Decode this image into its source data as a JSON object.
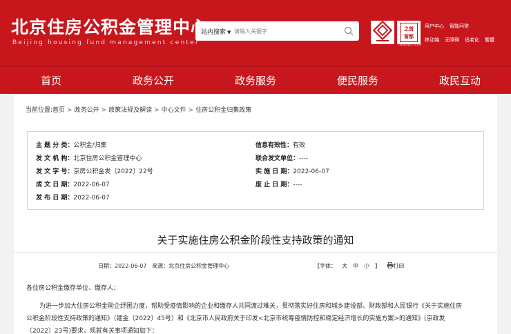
{
  "header": {
    "title": "北京住房公积金管理中心",
    "subtitle": "Beijing housing fund management center",
    "search": {
      "scope": "站内搜索",
      "placeholder": "请输入关键字"
    },
    "logo_b_text_top": "之首",
    "logo_b_text_bottom": "窗都",
    "logo_b_caption": "Beijing·China",
    "tools_row1": [
      "用户中心",
      "智能问答"
    ],
    "tools_row2": [
      "移动端",
      "无障碍",
      "适老化",
      "繁體"
    ]
  },
  "nav": [
    "首页",
    "政务公开",
    "政务服务",
    "便民服务",
    "政民互动"
  ],
  "breadcrumb": [
    "当前位置:首页",
    "政务公开",
    "政策法规及解读",
    "中心文件",
    "住房公积金归集政策"
  ],
  "meta": {
    "left": [
      {
        "label": "主 题 分 类：",
        "value": "公积金/归集"
      },
      {
        "label": "发 文 机 构：",
        "value": "北京住房公积金管理中心"
      },
      {
        "label": "发 文 字 号：",
        "value": "京房公积金发〔2022〕22号"
      },
      {
        "label": "成 文 日 期：",
        "value": "2022-06-07"
      },
      {
        "label": "发 布 日 期：",
        "value": "2022-06-07"
      }
    ],
    "right": [
      {
        "label": "信息有效性：",
        "value": "有效"
      },
      {
        "label": "联合发文单位：",
        "value": "----"
      },
      {
        "label": "实 施 日 期：",
        "value": "2022-06-07"
      },
      {
        "label": "废 止 日 期：",
        "value": "----"
      }
    ]
  },
  "doc_title": "关于实施住房公积金阶段性支持政策的通知",
  "info": {
    "date": "日期：2022-06-07",
    "source": "来源：北京住房公积金管理中心",
    "font_label": "【字体：",
    "font_large": "大",
    "font_medium": "中",
    "font_small": "小",
    "font_end": "】",
    "print": "打印"
  },
  "body": {
    "salutation": "各住房公积金缴存单位、缴存人：",
    "p1_line1": "为进一步加大住房公积金助企纾困力度，帮助受疫情影响的企业和缴存人共同渡过难关，贯彻落实好住房和城乡建设部、财政部和人民银行《关于实施住房",
    "p1_line2": "公积金阶段性支持政策的通知》（建金〔2022〕45号）和《北京市人民政府关于印发<北京市统筹疫情防控和稳定经济增长的实施方案>的通知》(京政发",
    "p1_line3": "〔2022〕23号)要求，现就有关事项通知如下："
  }
}
